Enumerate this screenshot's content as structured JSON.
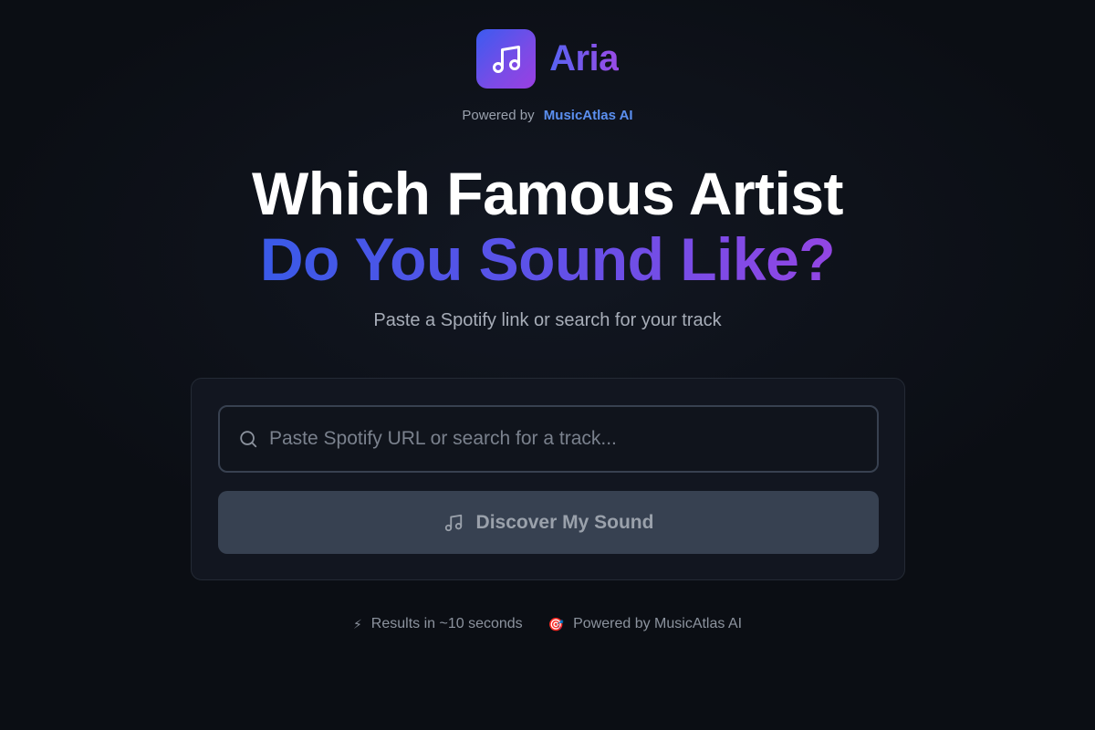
{
  "brand": {
    "name": "Aria",
    "logo_icon": "music-note-icon",
    "gradient_start": "#3b5bf0",
    "gradient_end": "#9a3fe2"
  },
  "powered_by": {
    "prefix": "Powered by",
    "name": "MusicAtlas AI",
    "link_color": "#5b8ff0"
  },
  "headline": {
    "line1": "Which Famous Artist",
    "line2": "Do You Sound Like?"
  },
  "subtitle": "Paste a Spotify link or search for your track",
  "search": {
    "placeholder": "Paste Spotify URL or search for a track...",
    "value": "",
    "icon": "search-icon"
  },
  "cta": {
    "label": "Discover My Sound",
    "icon": "music-note-icon",
    "state": "disabled"
  },
  "features": [
    {
      "icon": "⚡",
      "text": "Results in ~10 seconds"
    },
    {
      "icon": "🎯",
      "text": "Powered by MusicAtlas AI"
    }
  ]
}
